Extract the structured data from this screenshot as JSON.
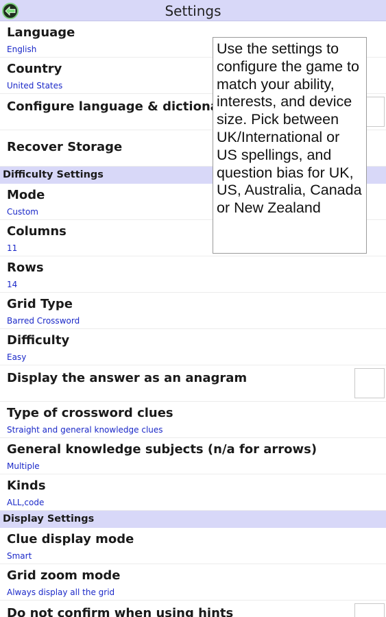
{
  "title": "Settings",
  "rows_top": [
    {
      "label": "Language",
      "value": "English"
    },
    {
      "label": "Country",
      "value": "United States"
    },
    {
      "label": "Configure language & dictionar",
      "value": ""
    },
    {
      "label": "Recover Storage",
      "value": ""
    }
  ],
  "section_difficulty": "Difficulty Settings",
  "rows_difficulty": [
    {
      "label": "Mode",
      "value": "Custom"
    },
    {
      "label": "Columns",
      "value": "11"
    },
    {
      "label": "Rows",
      "value": "14"
    },
    {
      "label": "Grid Type",
      "value": "Barred Crossword"
    },
    {
      "label": "Difficulty",
      "value": "Easy"
    },
    {
      "label": "Display the answer as an anagram",
      "value": ""
    },
    {
      "label": "Type of crossword clues",
      "value": "Straight and general knowledge clues"
    },
    {
      "label": "General knowledge subjects (n/a for arrows)",
      "value": "Multiple"
    },
    {
      "label": "Kinds",
      "value": "ALL,code"
    }
  ],
  "section_display": "Display Settings",
  "rows_display": [
    {
      "label": "Clue display mode",
      "value": "Smart"
    },
    {
      "label": "Grid zoom mode",
      "value": "Always display all the grid"
    },
    {
      "label": "Do not confirm when using hints",
      "value": ""
    }
  ],
  "tooltip": "Use the settings to configure the game to match your ability, interests, and device size. Pick between UK/International or US spellings, and question bias for UK, US, Australia, Canada or New Zealand"
}
